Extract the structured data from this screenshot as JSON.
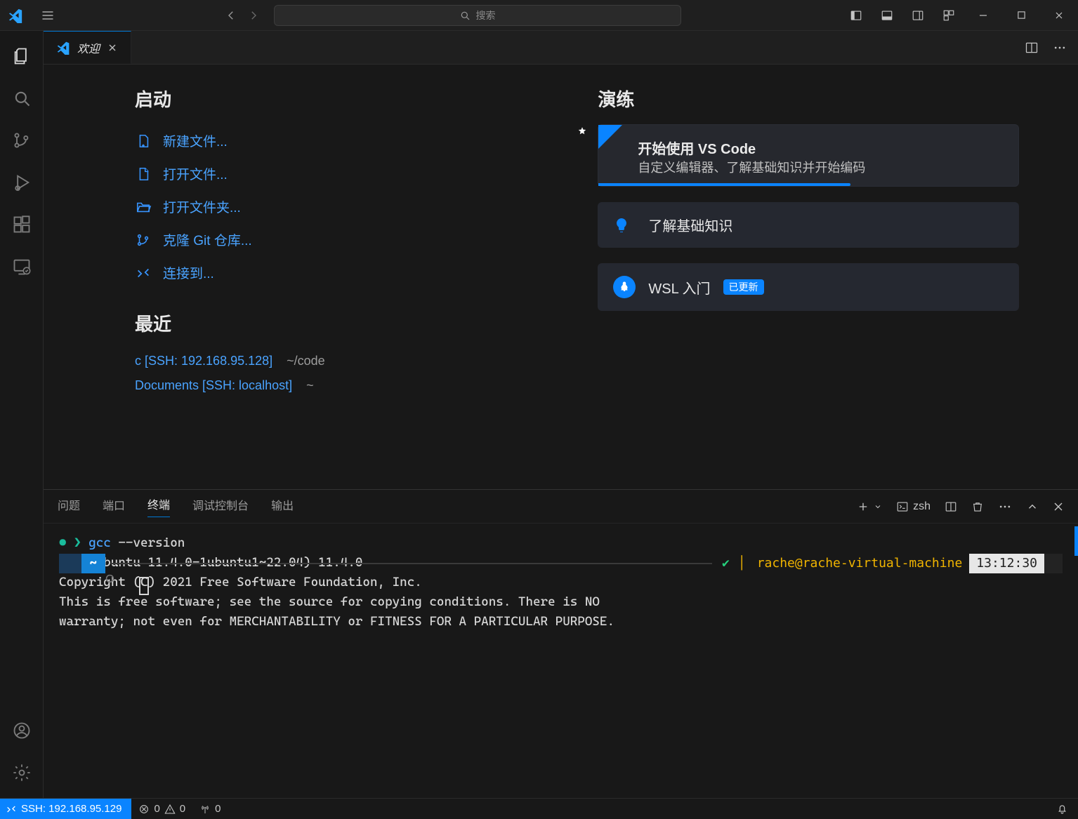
{
  "search_placeholder": "搜索",
  "tab_title": "欢迎",
  "welcome": {
    "start_heading": "启动",
    "start_items": [
      {
        "label": "新建文件..."
      },
      {
        "label": "打开文件..."
      },
      {
        "label": "打开文件夹..."
      },
      {
        "label": "克隆 Git 仓库..."
      },
      {
        "label": "连接到..."
      }
    ],
    "recent_heading": "最近",
    "recent_items": [
      {
        "name": "c [SSH: 192.168.95.128]",
        "path": "~/code"
      },
      {
        "name": "Documents [SSH: localhost]",
        "path": "~"
      }
    ],
    "walk_heading": "演练",
    "card_primary_title": "开始使用 VS Code",
    "card_primary_desc": "自定义编辑器、了解基础知识并开始编码",
    "card_secondary": "了解基础知识",
    "card_wsl": "WSL 入门",
    "badge_updated": "已更新"
  },
  "panel": {
    "tabs": {
      "problems": "问题",
      "ports": "端口",
      "terminal": "终端",
      "debug": "调试控制台",
      "output": "输出"
    },
    "shell_label": "zsh"
  },
  "terminal": {
    "cmd_name": "gcc",
    "cmd_arg": "--version",
    "l2": "gcc (Ubuntu 11.4.0-1ubuntu1~22.04) 11.4.0",
    "l3": "Copyright (C) 2021 Free Software Foundation, Inc.",
    "l4": "This is free software; see the source for copying conditions.  There is NO",
    "l5": "warranty; not even for MERCHANTABILITY or FITNESS FOR A PARTICULAR PURPOSE.",
    "prompt_user": "rache@rache-virtual-machine",
    "prompt_time": "13:12:30",
    "prompt_tilde": "~"
  },
  "status": {
    "remote": "SSH: 192.168.95.129",
    "errors": "0",
    "warnings": "0",
    "radio": "0"
  }
}
